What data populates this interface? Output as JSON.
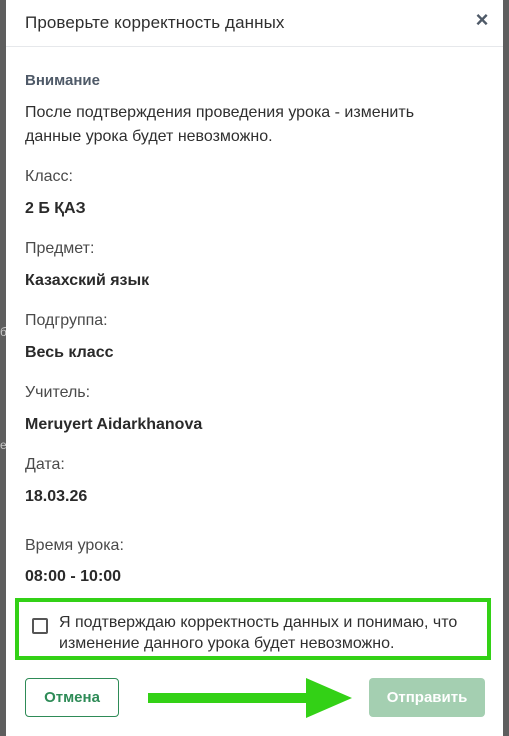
{
  "dialog": {
    "title": "Проверьте корректность данных",
    "close_glyph": "×"
  },
  "attention": {
    "heading": "Внимание",
    "text": "После подтверждения проведения урока - изменить данные урока будет невозможно."
  },
  "fields": [
    {
      "label": "Класс:",
      "value": "2 Б ҚАЗ"
    },
    {
      "label": "Предмет:",
      "value": "Казахский язык"
    },
    {
      "label": "Подгруппа:",
      "value": "Весь класс"
    },
    {
      "label": "Учитель:",
      "value": "Meruyert Aidarkhanova"
    },
    {
      "label": "Дата:",
      "value": "18.03.26"
    },
    {
      "label": "Время урока:",
      "value": "08:00 - 10:00"
    }
  ],
  "confirm": {
    "checked": false,
    "text": "Я подтверждаю корректность данных и понимаю, что изменение данного урока будет невозможно."
  },
  "buttons": {
    "cancel": "Отмена",
    "submit": "Отправить"
  },
  "icons": {
    "close": "close-icon",
    "checkbox": "checkbox-icon",
    "arrow": "arrow-right-icon"
  },
  "colors": {
    "highlight": "#33d116",
    "primary_green": "#2e8b57",
    "submit_disabled": "#a4cfb1",
    "attention_heading": "#4f5a68"
  }
}
